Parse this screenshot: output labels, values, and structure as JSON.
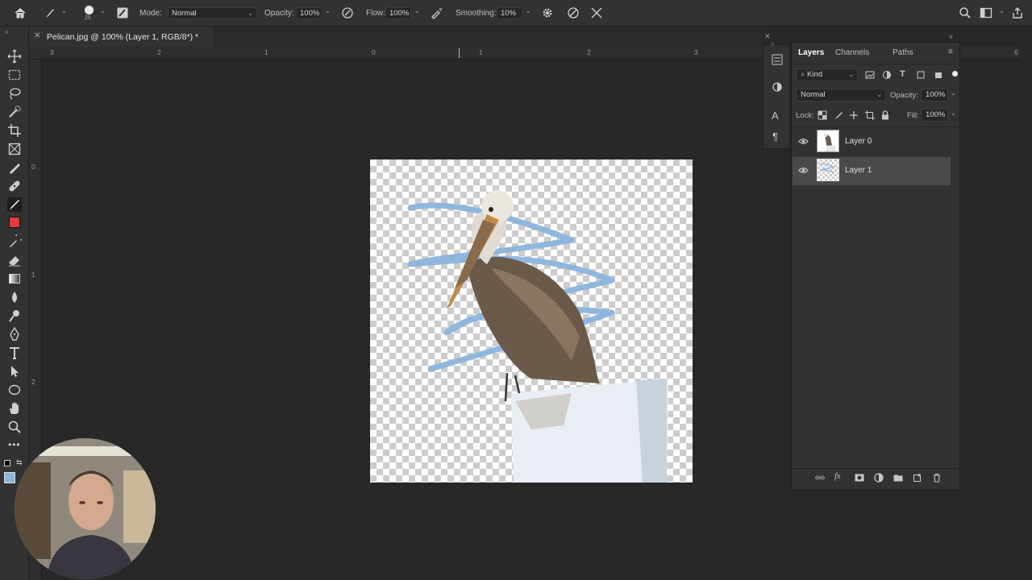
{
  "options_bar": {
    "brush_size": "25",
    "mode_label": "Mode:",
    "mode_value": "Normal",
    "opacity_label": "Opacity:",
    "opacity_value": "100%",
    "flow_label": "Flow:",
    "flow_value": "100%",
    "smoothing_label": "Smoothing:",
    "smoothing_value": "10%"
  },
  "document": {
    "tab_title": "Pelican.jpg @ 100% (Layer 1, RGB/8*) *",
    "ruler_top_numbers": [
      "3",
      "2",
      "1",
      "0",
      "1",
      "2",
      "3",
      "6"
    ],
    "ruler_left_numbers": [
      "0",
      "1",
      "2"
    ]
  },
  "layers_panel": {
    "tabs": [
      "Layers",
      "Channels",
      "Paths"
    ],
    "active_tab": "Layers",
    "filter_label": "Kind",
    "blend_mode": "Normal",
    "opacity_label": "Opacity:",
    "opacity_value": "100%",
    "lock_label": "Lock:",
    "fill_label": "Fill:",
    "fill_value": "100%",
    "layers": [
      {
        "name": "Layer 0",
        "visible": true,
        "selected": false
      },
      {
        "name": "Layer 1",
        "visible": true,
        "selected": true
      }
    ]
  },
  "colors": {
    "foreground": "#e8393b",
    "background": "#8ab4d8",
    "stroke": "#8ab4dc"
  }
}
